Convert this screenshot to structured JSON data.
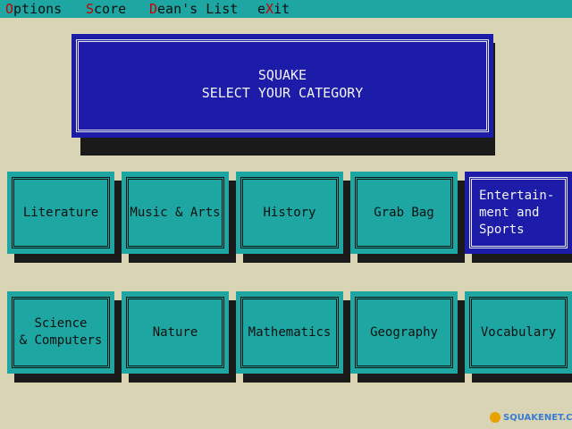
{
  "menu": [
    {
      "hotkey": "O",
      "rest": "ptions"
    },
    {
      "hotkey": "S",
      "rest": "core"
    },
    {
      "hotkey": "D",
      "rest": "ean's List"
    },
    {
      "hotkey": "e",
      "rest": "X",
      "tail": "it"
    }
  ],
  "title": {
    "line1": "SQUAKE",
    "line2": "SELECT YOUR CATEGORY"
  },
  "categories": [
    {
      "label": "Literature"
    },
    {
      "label": "Music & Arts"
    },
    {
      "label": "History"
    },
    {
      "label": "Grab Bag"
    },
    {
      "label": "Entertain-\nment and\nSports",
      "selected": true
    },
    {
      "label": "Science\n& Computers"
    },
    {
      "label": "Nature"
    },
    {
      "label": "Mathematics"
    },
    {
      "label": "Geography"
    },
    {
      "label": "Vocabulary"
    }
  ],
  "watermark": "SQUAKENET.COM",
  "colors": {
    "background": "#d8d4b4",
    "menubar": "#1ea7a2",
    "tile": "#1ea7a2",
    "selected": "#1c1ca8",
    "hotkey": "#c80000"
  }
}
